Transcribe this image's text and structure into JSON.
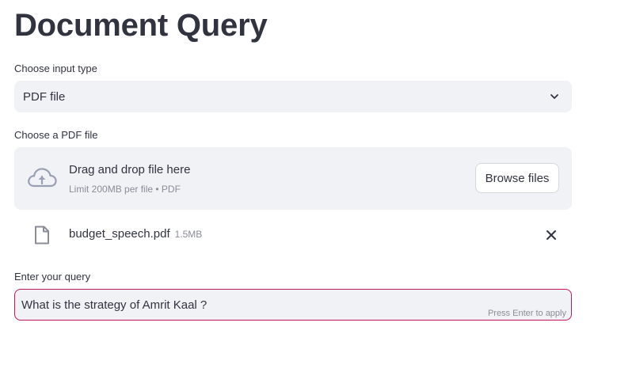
{
  "page": {
    "title": "Document Query"
  },
  "input_type": {
    "label": "Choose input type",
    "selected": "PDF file",
    "icon": "chevron-down-icon"
  },
  "uploader": {
    "label": "Choose a PDF file",
    "drop_text": "Drag and drop file here",
    "limit_text": "Limit 200MB per file • PDF",
    "browse_label": "Browse files",
    "icon": "cloud-upload-icon"
  },
  "uploaded_file": {
    "name": "budget_speech.pdf",
    "size": "1.5MB",
    "icon": "file-icon",
    "remove_icon": "close-icon"
  },
  "query": {
    "label": "Enter your query",
    "value": "What is the strategy of Amrit Kaal ?",
    "hint": "Press Enter to apply",
    "border_color": "#c2185b"
  },
  "colors": {
    "text": "#31333f",
    "widget_bg": "#f0f2f6",
    "muted": "#8a8d97"
  }
}
